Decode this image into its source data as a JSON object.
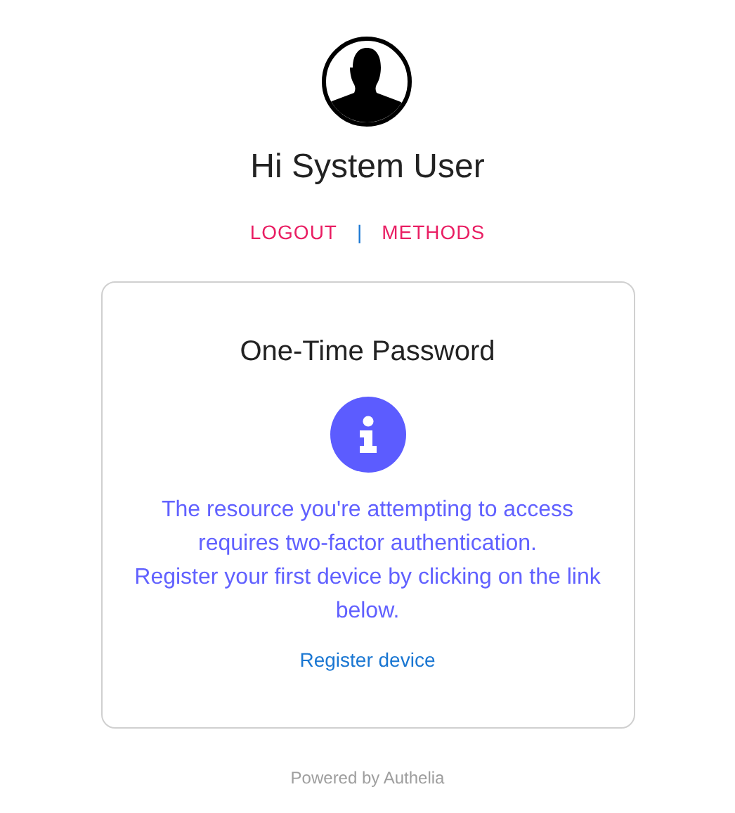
{
  "user": {
    "greeting": "Hi System User"
  },
  "nav": [
    {
      "label": "LOGOUT"
    },
    {
      "label": "METHODS"
    }
  ],
  "nav_separator": "|",
  "card": {
    "title": "One-Time Password",
    "message": [
      "The resource you're attempting to access requires two-factor authentication.",
      "Register your first device by clicking on the link below."
    ],
    "link": "Register device"
  },
  "footer": "Powered by Authelia"
}
